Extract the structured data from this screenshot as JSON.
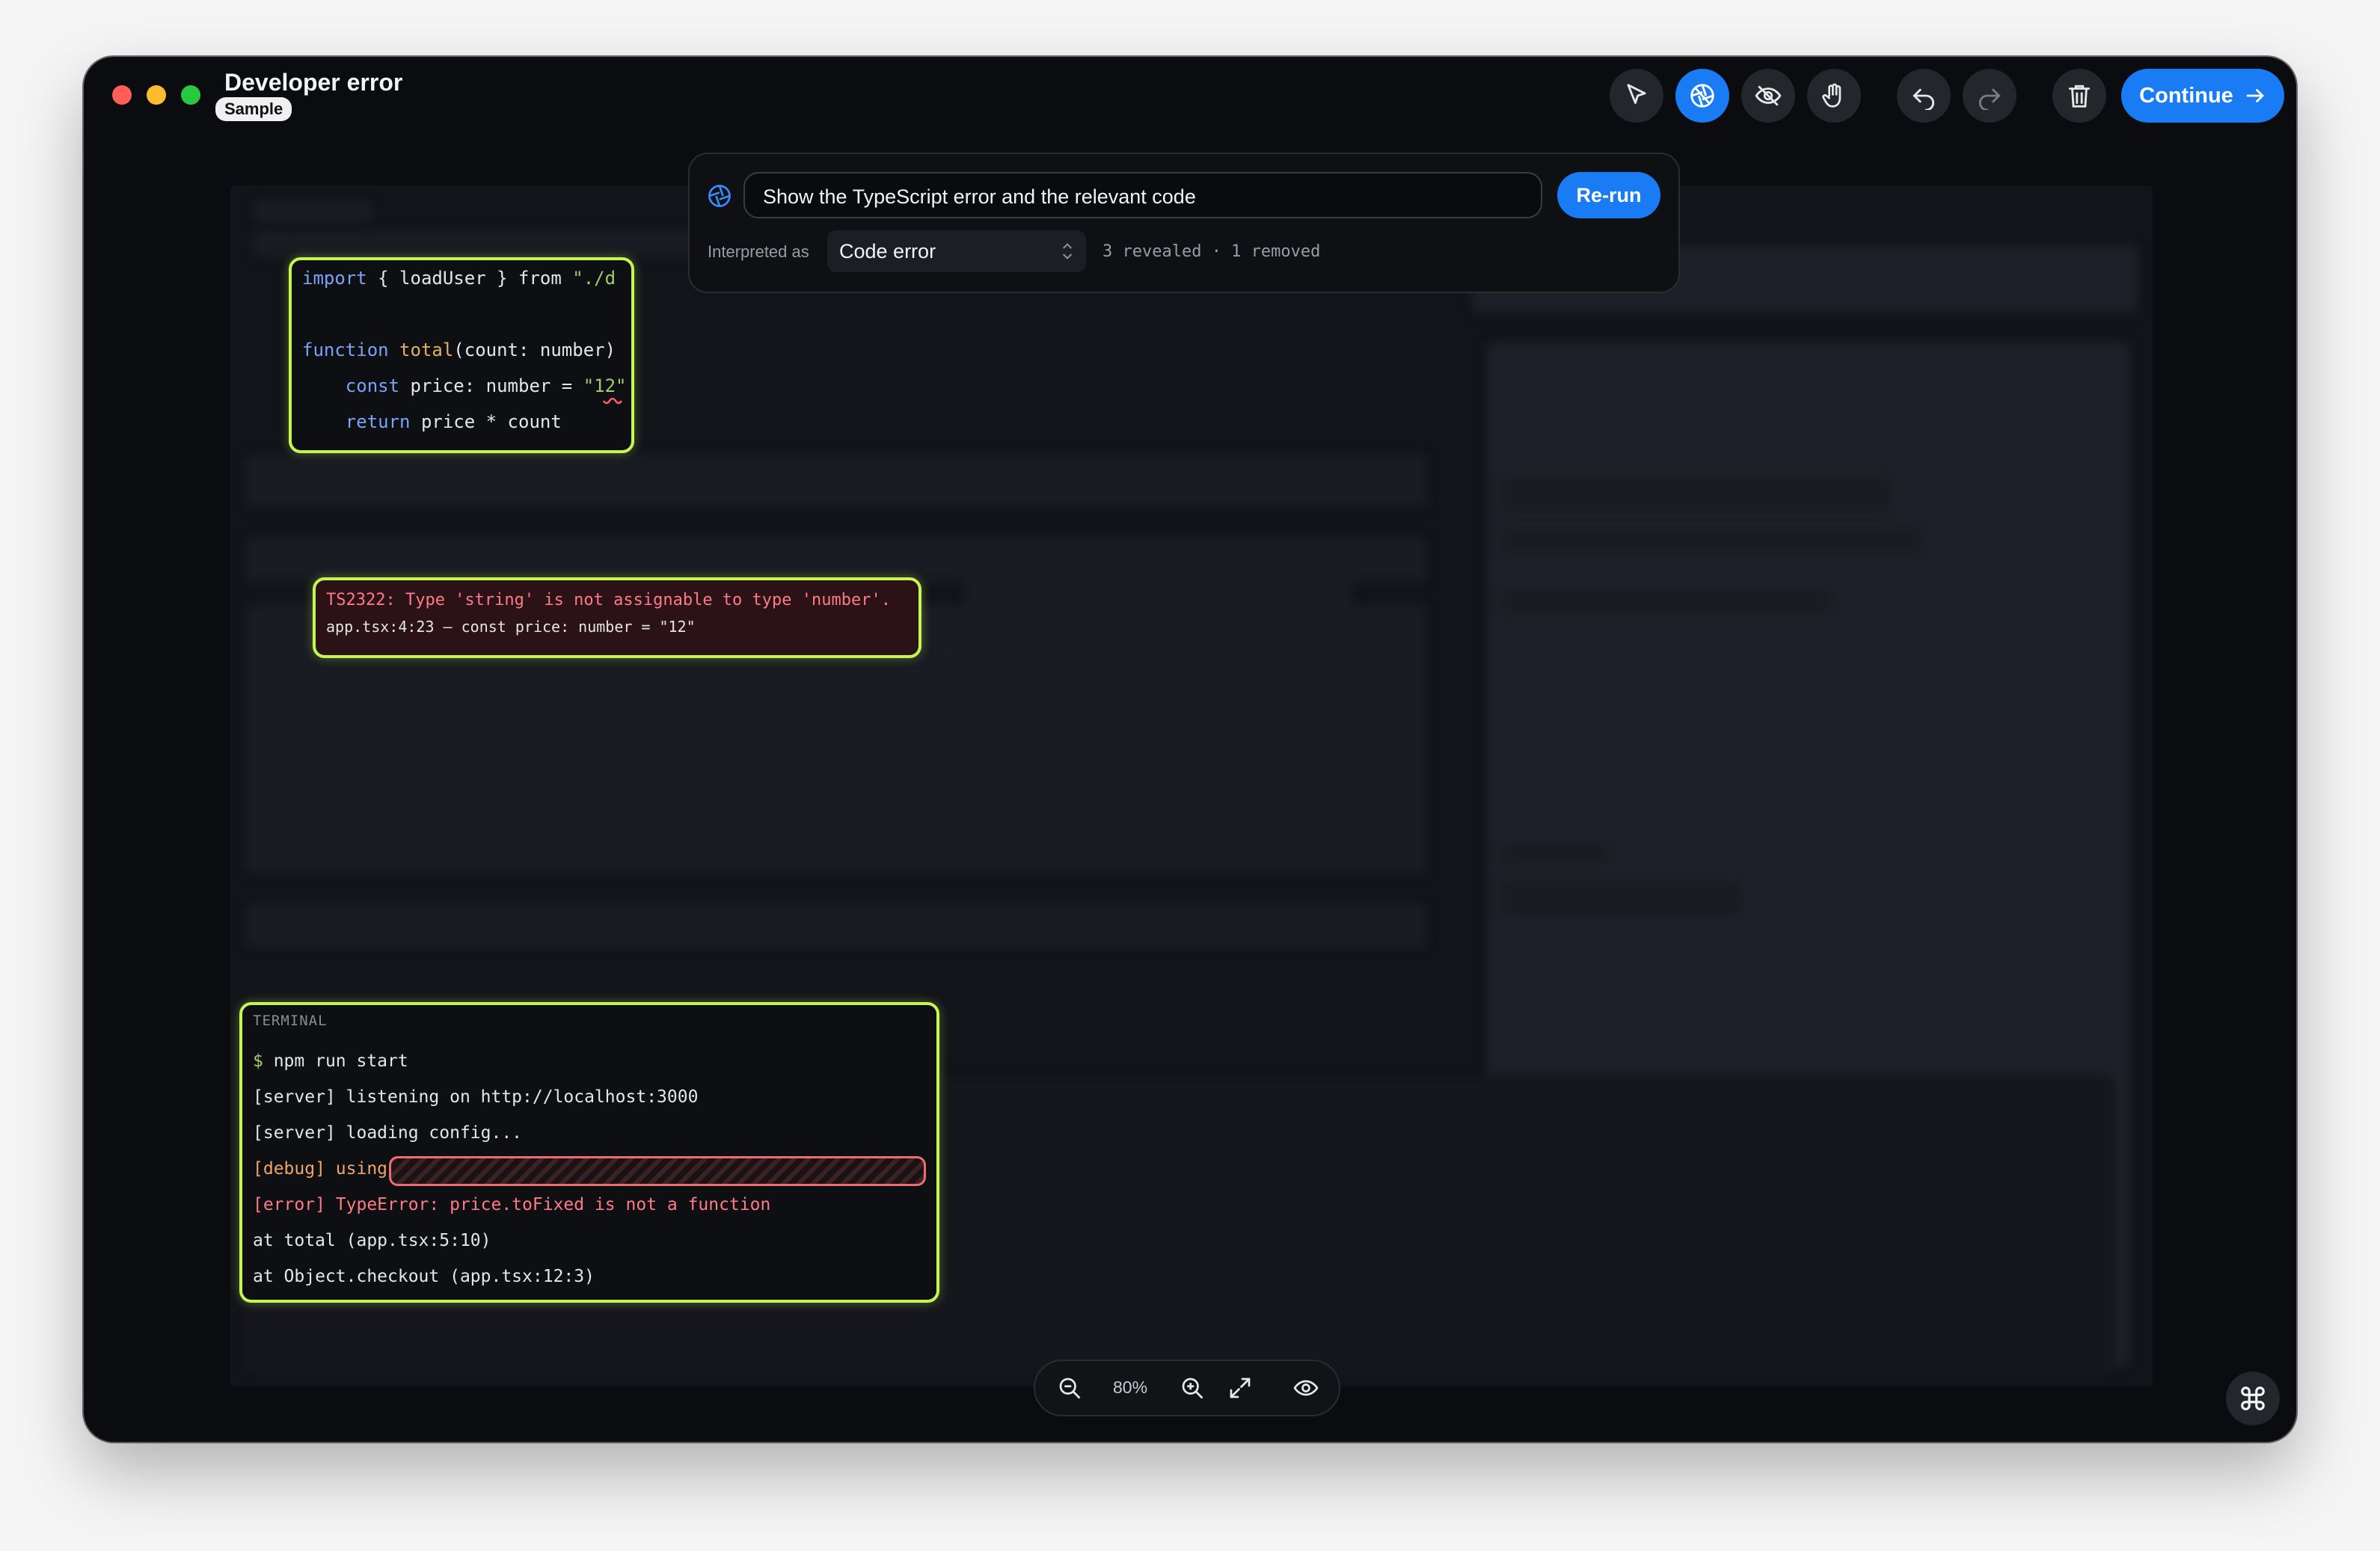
{
  "window": {
    "title": "Developer error",
    "badge": "Sample"
  },
  "toolbar": {
    "tools": [
      {
        "name": "select",
        "icon": "cursor-arrow-icon",
        "active": false
      },
      {
        "name": "reveal",
        "icon": "aperture-icon",
        "active": true
      },
      {
        "name": "hide",
        "icon": "eye-off-icon",
        "active": false
      },
      {
        "name": "pan",
        "icon": "hand-icon",
        "active": false
      }
    ],
    "undo_icon": "undo-icon",
    "redo_icon": "redo-icon",
    "delete_icon": "trash-icon",
    "continue_label": "Continue",
    "colors": {
      "accent": "#1a7cf5",
      "highlight": "#c6f452",
      "error": "#ff7a85"
    }
  },
  "prompt": {
    "value": "Show the TypeScript error and the relevant code",
    "rerun_label": "Re-run",
    "interpreted_label": "Interpreted as",
    "interpreted_value": "Code error",
    "counts": "3 revealed · 1 removed"
  },
  "code_panel": {
    "lines": [
      "import { loadUser } from \"./d",
      "",
      "function total(count: number)",
      "    const price: number = \"12\"",
      "    return price * count"
    ]
  },
  "error_panel": {
    "message": "TS2322: Type 'string' is not assignable to type 'number'.",
    "location": "app.tsx:4:23 — const price: number = \"12\""
  },
  "terminal": {
    "title": "TERMINAL",
    "lines": [
      "$ npm run start",
      "[server] listening on http://localhost:3000",
      "[server] loading config...",
      "[debug] using",
      "[error] TypeError: price.toFixed is not a function",
      "at total (app.tsx:5:10)",
      "at Object.checkout (app.tsx:12:3)"
    ]
  },
  "zoom": {
    "level": "80%"
  }
}
